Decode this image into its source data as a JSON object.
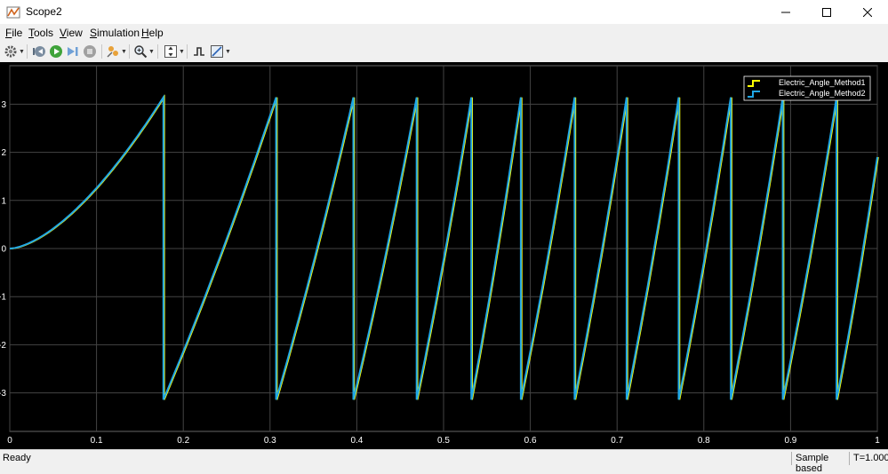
{
  "window": {
    "title": "Scope2"
  },
  "menu": [
    {
      "label": "File",
      "u": "F",
      "rest": "ile"
    },
    {
      "label": "Tools",
      "u": "T",
      "rest": "ools"
    },
    {
      "label": "View",
      "u": "V",
      "rest": "iew"
    },
    {
      "label": "Simulation",
      "u": "S",
      "rest": "imulation"
    },
    {
      "label": "Help",
      "u": "H",
      "rest": "elp"
    }
  ],
  "toolbar": {
    "icons": [
      "settings-icon",
      "step-back-icon",
      "run-icon",
      "step-forward-icon",
      "stop-icon",
      "highlight-icon",
      "zoom-icon",
      "scale-axes-icon",
      "triggers-icon",
      "measurements-icon"
    ]
  },
  "status": {
    "left": "Ready",
    "mode": "Sample based",
    "time": "T=1.000"
  },
  "colors": {
    "method1": "#ffff00",
    "method2": "#1fa6e6",
    "grid": "#444444",
    "axis_text": "#ffffff"
  },
  "chart_data": {
    "type": "line",
    "xlim": [
      0,
      1
    ],
    "ylim": [
      -3.8,
      3.8
    ],
    "x_ticks": [
      0,
      0.1,
      0.2,
      0.3,
      0.4,
      0.5,
      0.6,
      0.7,
      0.8,
      0.9,
      1
    ],
    "x_tick_labels": [
      "0",
      "0.1",
      "0.2",
      "0.3",
      "0.4",
      "0.5",
      "0.6",
      "0.7",
      "0.8",
      "0.9",
      "1"
    ],
    "y_ticks": [
      3,
      2,
      1,
      0,
      -1,
      -2,
      -3
    ],
    "y_tick_labels": [
      "3",
      "2",
      "1",
      "0",
      "-1",
      "-2",
      "-3"
    ],
    "grid": true,
    "legend_position": "top-right",
    "wrap_times": [
      0.177,
      0.307,
      0.396,
      0.469,
      0.532,
      0.589,
      0.651,
      0.711,
      0.771,
      0.831,
      0.891,
      0.953
    ],
    "final_value": 1.9,
    "series": [
      {
        "name": "Electric_Angle_Method1",
        "color": "#ffff00"
      },
      {
        "name": "Electric_Angle_Method2",
        "color": "#1fa6e6"
      }
    ]
  }
}
